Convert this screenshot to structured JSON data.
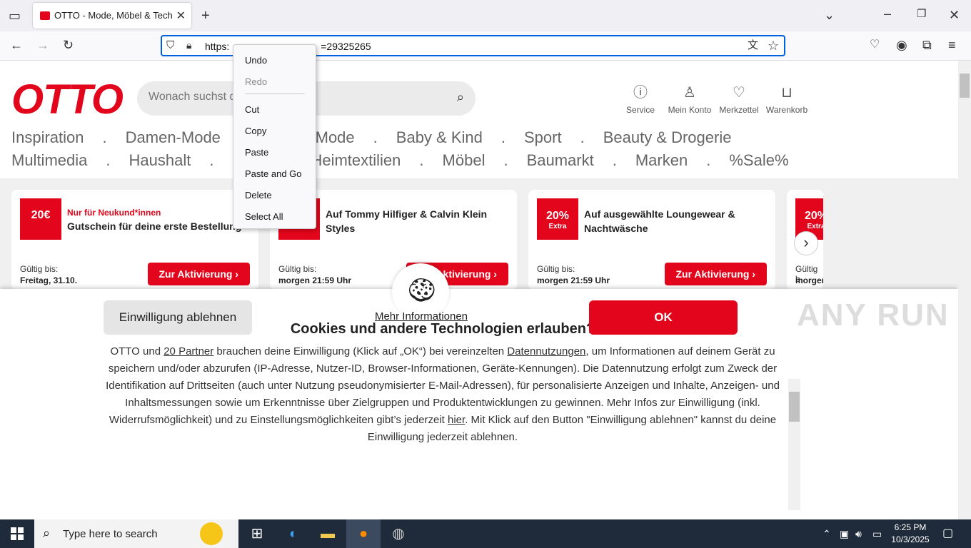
{
  "browser": {
    "tab_title": "OTTO - Mode, Möbel & Technik",
    "url": "https://www.otto.de/?affiliate=29325265",
    "url_visible_prefix": "https:",
    "url_visible_suffix": "=29325265"
  },
  "context_menu": {
    "items": [
      "Undo",
      "Redo",
      "Cut",
      "Copy",
      "Paste",
      "Paste and Go",
      "Delete",
      "Select All"
    ]
  },
  "site": {
    "logo": "OTTO",
    "search_placeholder": "Wonach suchst du?",
    "top_icons": [
      "Service",
      "Mein Konto",
      "Merkzettel",
      "Warenkorb"
    ],
    "nav_row1": [
      "Inspiration",
      "Damen-Mode",
      "Herren-Mode",
      "Baby & Kind",
      "Sport",
      "Beauty & Drogerie"
    ],
    "nav_row2": [
      "Multimedia",
      "Haushalt",
      "Heimtextilien",
      "Möbel",
      "Baumarkt",
      "Marken",
      "%Sale%"
    ],
    "nav_sep": "."
  },
  "promos": [
    {
      "badge": "20€",
      "badge_sub": "",
      "eyebrow": "Nur für Neukund*innen",
      "headline": "Gutschein für deine erste Bestellung",
      "valid_label": "Gültig bis:",
      "valid_value": "Freitag, 31.10.",
      "cta": "Zur Aktivierung"
    },
    {
      "badge": "",
      "badge_sub": "",
      "eyebrow": "",
      "headline": "Auf Tommy Hilfiger & Calvin Klein Styles",
      "valid_label": "Gültig bis:",
      "valid_value": "morgen 21:59 Uhr",
      "cta": "Zur Aktivierung"
    },
    {
      "badge": "20%",
      "badge_sub": "Extra",
      "eyebrow": "",
      "headline": "Auf ausgewählte Loungewear & Nachtwäsche",
      "valid_label": "Gültig bis:",
      "valid_value": "morgen 21:59 Uhr",
      "cta": "Zur Aktivierung"
    },
    {
      "badge": "20%",
      "badge_sub": "Extra",
      "eyebrow": "",
      "headline": "",
      "valid_label": "Gültig b",
      "valid_value": "morgen",
      "cta": ""
    }
  ],
  "cookie": {
    "title": "Cookies und andere Technologien erlauben?",
    "body_1": "OTTO und ",
    "link_partner": "20 Partner",
    "body_2": " brauchen deine Einwilligung (Klick auf „OK“) bei vereinzelten ",
    "link_data": "Datennutzungen",
    "body_3": ", um Informationen auf deinem Gerät zu speichern und/oder abzurufen (IP-Adresse, Nutzer-ID, Browser-Informationen, Geräte-Kennungen). Die Datennutzung erfolgt zum Zweck der Identifikation auf Drittseiten (auch unter Nutzung pseudonymisierter E-Mail-Adressen), für personalisierte Anzeigen und Inhalte, Anzeigen- und Inhaltsmessungen sowie um Erkenntnisse über Zielgruppen und Produktentwicklungen zu gewinnen. Mehr Infos zur Einwilligung (inkl. Widerrufsmöglichkeit) und zu Einstellungsmöglichkeiten gibt’s jederzeit ",
    "link_here": "hier",
    "body_4": ". Mit Klick auf den Button \"Einwilligung ablehnen\" kannst du deine Einwilligung jederzeit ablehnen.",
    "decline": "Einwilligung ablehnen",
    "more": "Mehr Informationen",
    "ok": "OK"
  },
  "watermark": "ANY RUN",
  "taskbar": {
    "search_placeholder": "Type here to search",
    "time": "6:25 PM",
    "date": "10/3/2025"
  },
  "colors": {
    "brand": "#e3051b",
    "taskbar": "#1f2b3a",
    "focus": "#0061e0"
  }
}
